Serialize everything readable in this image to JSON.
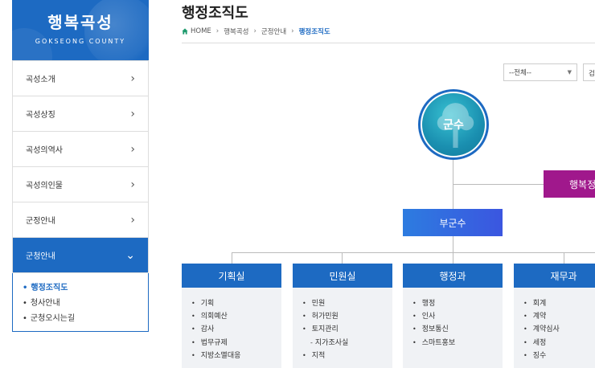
{
  "brand": {
    "title": "행복곡성",
    "subtitle": "GOKSEONG COUNTY"
  },
  "sidebar": {
    "items": [
      {
        "label": "곡성소개"
      },
      {
        "label": "곡성상징"
      },
      {
        "label": "곡성의역사"
      },
      {
        "label": "곡성의인물"
      },
      {
        "label": "군정안내"
      },
      {
        "label": "군청안내"
      }
    ],
    "submenu": [
      {
        "label": "행정조직도"
      },
      {
        "label": "청사안내"
      },
      {
        "label": "군청오시는길"
      }
    ]
  },
  "page": {
    "title": "행정조직도",
    "breadcrumb": [
      "HOME",
      "행복곡성",
      "군정안내",
      "행정조직도"
    ]
  },
  "filter": {
    "selected": "--전체--",
    "search_label": "검"
  },
  "org": {
    "mayor": "군수",
    "aide": "행복정",
    "vice": "부군수",
    "departments": [
      {
        "name": "기획실",
        "items": [
          "기획",
          "의회예산",
          "감사",
          "법무규제",
          "지방소멸대응"
        ]
      },
      {
        "name": "민원실",
        "items": [
          "민원",
          "허가민원",
          "토지관리",
          "- 지가조사실",
          "지적"
        ]
      },
      {
        "name": "행정과",
        "items": [
          "행정",
          "인사",
          "정보통신",
          "스마트홍보"
        ]
      },
      {
        "name": "재무과",
        "items": [
          "회계",
          "계약",
          "계약심사",
          "세정",
          "징수"
        ]
      }
    ]
  },
  "colors": {
    "primary": "#1d6ac2",
    "aide": "#a0188c",
    "mayor_inner": "#1a8fb0"
  }
}
